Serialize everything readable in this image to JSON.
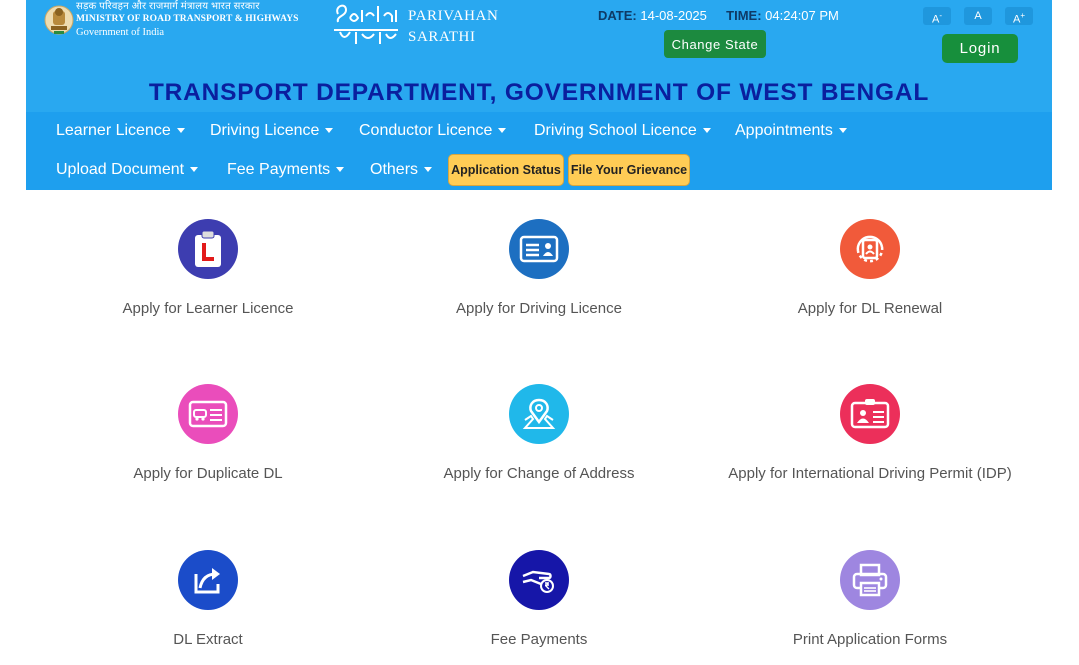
{
  "header": {
    "ministry_hindi": "सड़क परिवहन और राजमार्ग मंत्रालय भारत सरकार",
    "ministry_english": "MINISTRY OF ROAD TRANSPORT & HIGHWAYS",
    "government": "Government of India",
    "brand_line1": "PARIVAHAN",
    "brand_line2": "SARATHI",
    "date_label": "DATE:",
    "date_value": "14-08-2025",
    "time_label": "TIME:",
    "time_value": "04:24:07 PM",
    "change_state_label": "Change State",
    "font_decrease_label": "A",
    "font_decrease_sup": "-",
    "font_normal_label": "A",
    "font_increase_label": "A",
    "font_increase_sup": "+",
    "login_label": "Login",
    "department_title": "TRANSPORT DEPARTMENT, GOVERNMENT OF WEST BENGAL"
  },
  "nav": {
    "items": [
      {
        "label": "Learner Licence"
      },
      {
        "label": "Driving Licence"
      },
      {
        "label": "Conductor Licence"
      },
      {
        "label": "Driving School Licence"
      },
      {
        "label": "Appointments"
      },
      {
        "label": "Upload Document"
      },
      {
        "label": "Fee Payments"
      },
      {
        "label": "Others"
      }
    ],
    "application_status_label": "Application Status",
    "grievance_label": "File Your Grievance"
  },
  "services": [
    {
      "label": "Apply for Learner Licence",
      "icon": "learner-licence-icon",
      "color": "#3d3db0"
    },
    {
      "label": "Apply for Driving Licence",
      "icon": "driving-licence-icon",
      "color": "#1d6fc1"
    },
    {
      "label": "Apply for DL Renewal",
      "icon": "dl-renewal-icon",
      "color": "#f15a3a"
    },
    {
      "label": "Apply for Duplicate DL",
      "icon": "duplicate-dl-icon",
      "color": "#ea4dbb"
    },
    {
      "label": "Apply for Change of Address",
      "icon": "change-address-icon",
      "color": "#20b8ea"
    },
    {
      "label": "Apply for International Driving Permit (IDP)",
      "icon": "idp-icon",
      "color": "#ec2f5a"
    },
    {
      "label": "DL Extract",
      "icon": "dl-extract-icon",
      "color": "#1b4cc9"
    },
    {
      "label": "Fee Payments",
      "icon": "fee-payments-icon",
      "color": "#1616a8"
    },
    {
      "label": "Print Application Forms",
      "icon": "print-forms-icon",
      "color": "#9e86e0"
    }
  ]
}
